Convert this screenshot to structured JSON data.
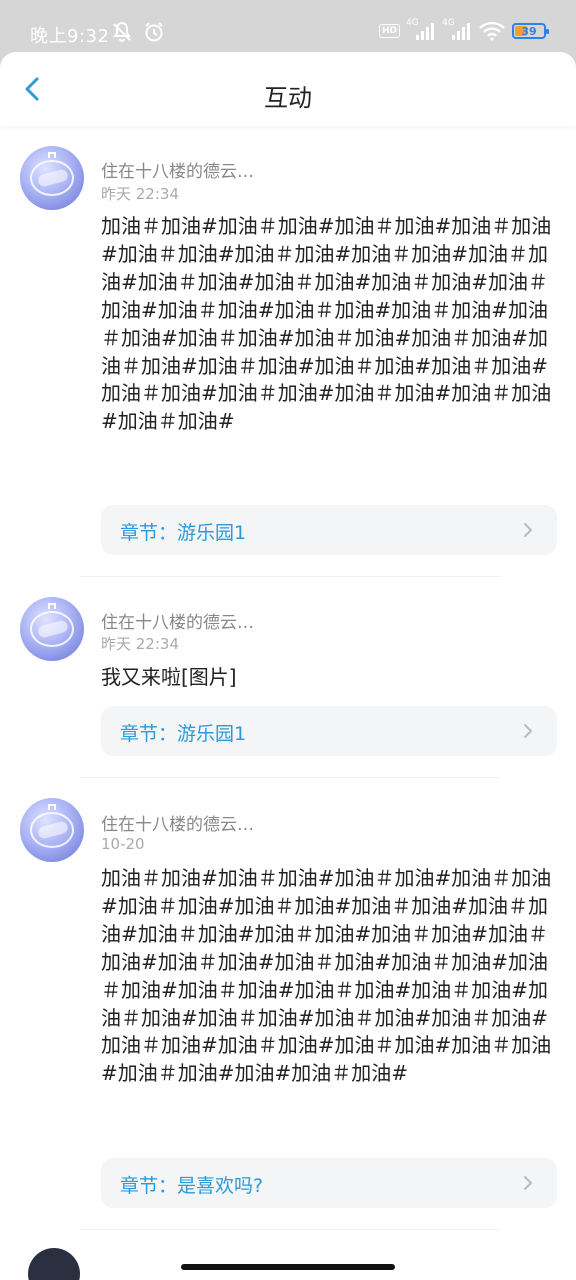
{
  "status_bar": {
    "time": "晚上9:32",
    "hd_badge": "HD",
    "net1": "4G",
    "net2": "4G",
    "battery_level": 0.39,
    "battery_text": "39",
    "icons": [
      "mute-icon",
      "alarm-icon",
      "signal-icon",
      "wifi-icon",
      "battery-icon"
    ]
  },
  "nav": {
    "title": "互动",
    "back_icon": "chevron-left-icon"
  },
  "posts": [
    {
      "user_name": "住在十八楼的德云…",
      "time": "昨天 22:34",
      "text": "加油＃加油#加油＃加油#加油＃加油#加油＃加油#加油＃加油#加油＃加油#加油＃加油#加油＃加油#加油＃加油#加油＃加油#加油＃加油#加油＃加油#加油＃加油#加油＃加油#加油＃加油#加油＃加油#加油＃加油#加油＃加油#加油＃加油#加油＃加油#加油＃加油#加油＃加油#加油＃加油#加油＃加油#加油＃加油#加油＃加油#加油＃加油#加油＃加油#",
      "chapter": "章节：游乐园1"
    },
    {
      "user_name": "住在十八楼的德云…",
      "time": "昨天 22:34",
      "text": "我又来啦[图片]",
      "chapter": "章节：游乐园1"
    },
    {
      "user_name": "住在十八楼的德云…",
      "time": "10-20",
      "text": "加油＃加油#加油＃加油#加油＃加油#加油＃加油#加油＃加油#加油＃加油#加油＃加油#加油＃加油#加油＃加油#加油＃加油#加油＃加油#加油＃加油#加油＃加油#加油＃加油#加油＃加油#加油＃加油#加油＃加油#加油＃加油#加油＃加油#加油＃加油#加油＃加油#加油＃加油#加油＃加油#加油＃加油#加油＃加油#加油＃加油#加油＃加油#加油＃加油#加油#加油＃加油#",
      "chapter": "章节：是喜欢吗?"
    }
  ]
}
